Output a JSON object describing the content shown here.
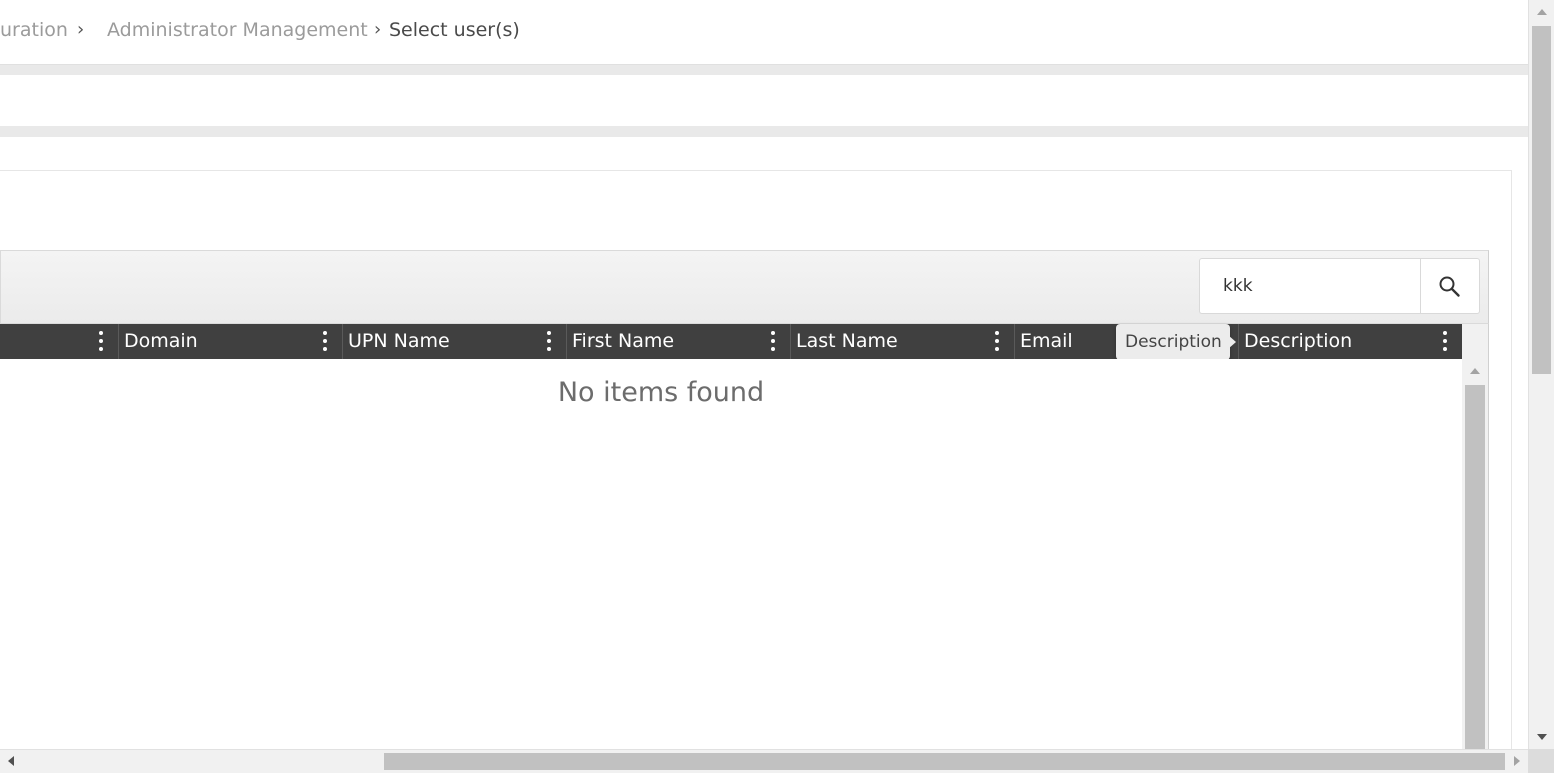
{
  "breadcrumb": {
    "items": [
      {
        "label": "uration"
      },
      {
        "label": "Administrator Management"
      },
      {
        "label": "Select user(s)"
      }
    ],
    "separator": "›"
  },
  "search": {
    "value": "kkk",
    "button_icon": "search-icon"
  },
  "grid": {
    "columns": [
      {
        "title": ""
      },
      {
        "title": "Domain"
      },
      {
        "title": "UPN Name"
      },
      {
        "title": "First Name"
      },
      {
        "title": "Last Name"
      },
      {
        "title": "Email"
      },
      {
        "title": "Description"
      }
    ],
    "column_menu_icon": "vertical-ellipsis-icon",
    "empty_message": "No items found",
    "tooltip": "Description"
  },
  "colors": {
    "header_background": "#404040",
    "header_text": "#ffffff",
    "breadcrumb_muted": "#9b9b9b",
    "breadcrumb_current": "#4a4a4a",
    "toolbar_background": "#eeeeee"
  }
}
